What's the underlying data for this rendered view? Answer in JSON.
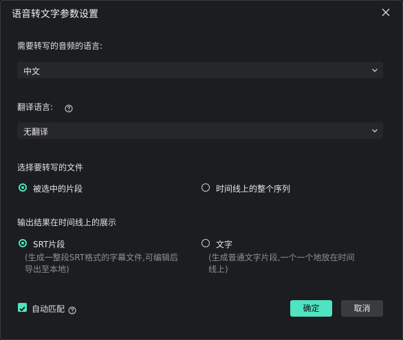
{
  "dialog": {
    "title": "语音转文字参数设置",
    "close_icon": "close-icon"
  },
  "source_language": {
    "label": "需要转写的音频的语言:",
    "value": "中文"
  },
  "translate_language": {
    "label": "翻译语言:",
    "value": "无翻译",
    "help_icon": "help-icon"
  },
  "file_selection": {
    "label": "选择要转写的文件",
    "options": [
      {
        "label": "被选中的片段",
        "checked": true
      },
      {
        "label": "时间线上的整个序列",
        "checked": false
      }
    ]
  },
  "output_display": {
    "label": "输出结果在时间线上的展示",
    "options": [
      {
        "label": "SRT片段",
        "checked": true,
        "desc_line1": "(生成一整段SRT格式的字幕文件,可编辑后",
        "desc_line2": "导出至本地)"
      },
      {
        "label": "文字",
        "checked": false,
        "desc_line1": "(生成普通文字片段,一个一个地放在时间",
        "desc_line2": "线上)"
      }
    ]
  },
  "auto_match": {
    "label": "自动匹配",
    "checked": true,
    "help_icon": "help-icon"
  },
  "buttons": {
    "ok": "确定",
    "cancel": "取消"
  },
  "colors": {
    "accent": "#4fe3c1",
    "background": "#1c1d20",
    "field": "#26272b"
  }
}
